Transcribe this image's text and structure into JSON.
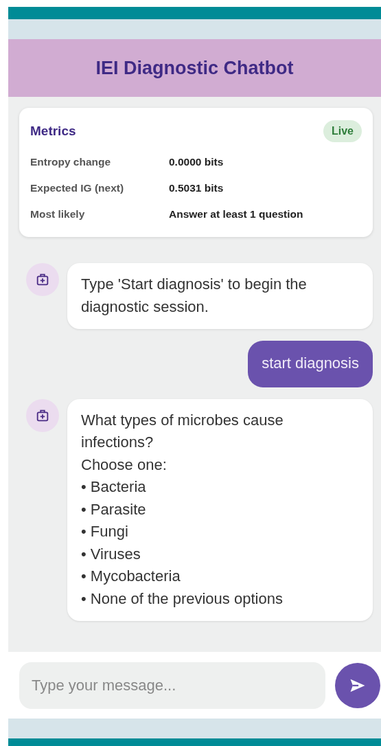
{
  "header": {
    "title": "IEI Diagnostic Chatbot"
  },
  "metrics": {
    "title": "Metrics",
    "badge": "Live",
    "rows": [
      {
        "label": "Entropy change",
        "value": "0.0000 bits"
      },
      {
        "label": "Expected IG (next)",
        "value": "0.5031 bits"
      },
      {
        "label": "Most likely",
        "value": "Answer at least 1 question"
      }
    ]
  },
  "messages": [
    {
      "kind": "bot",
      "lines": [
        "Type 'Start diagnosis' to begin the diagnostic session."
      ]
    },
    {
      "kind": "user",
      "lines": [
        "start diagnosis"
      ]
    },
    {
      "kind": "bot",
      "lines": [
        "What types of microbes cause infections?",
        "Choose one:",
        "• Bacteria",
        "• Parasite",
        "• Fungi",
        "• Viruses",
        "• Mycobacteria",
        "• None of the previous options"
      ]
    }
  ],
  "composer": {
    "placeholder": "Type your message..."
  }
}
